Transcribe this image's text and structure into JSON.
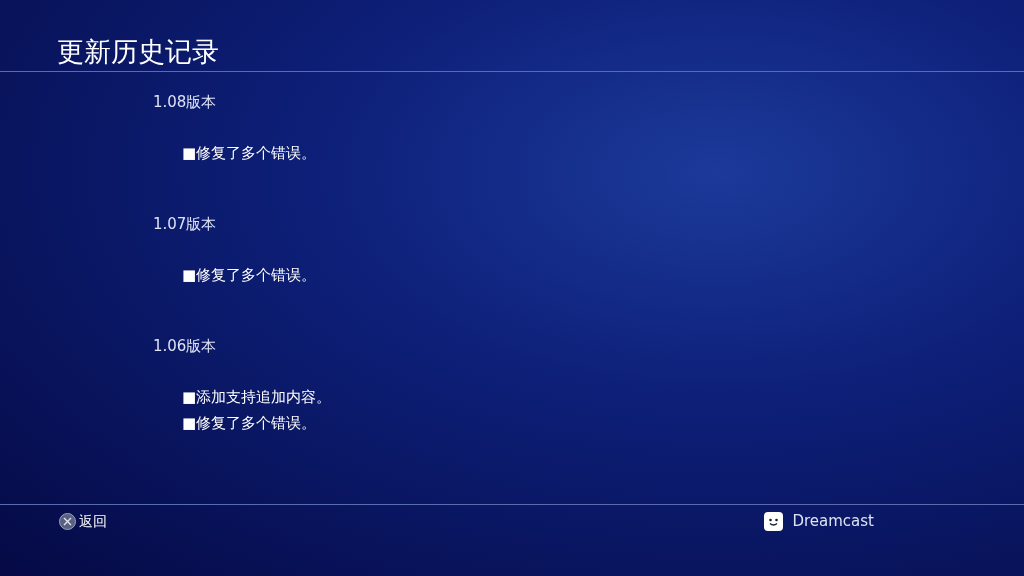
{
  "header": {
    "title": "更新历史记录"
  },
  "versions": [
    {
      "label": "1.08版本",
      "notes": [
        "■修复了多个错误。"
      ]
    },
    {
      "label": "1.07版本",
      "notes": [
        "■修复了多个错误。"
      ]
    },
    {
      "label": "1.06版本",
      "notes": [
        "■添加支持追加内容。",
        "■修复了多个错误。"
      ]
    }
  ],
  "footer": {
    "back": "返回",
    "user": "Dreamcast"
  }
}
